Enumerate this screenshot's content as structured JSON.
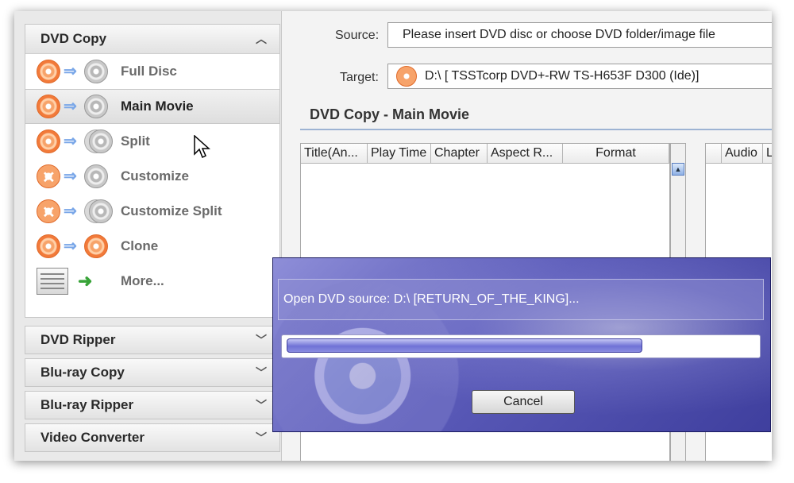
{
  "left_panel": {
    "dvd_copy": {
      "title": "DVD Copy",
      "items": [
        {
          "label": "Full Disc"
        },
        {
          "label": "Main Movie"
        },
        {
          "label": "Split"
        },
        {
          "label": "Customize"
        },
        {
          "label": "Customize Split"
        },
        {
          "label": "Clone"
        },
        {
          "label": "More..."
        }
      ]
    },
    "collapsed_sections": [
      "DVD Ripper",
      "Blu-ray Copy",
      "Blu-ray Ripper",
      "Video Converter"
    ]
  },
  "main": {
    "source_label": "Source:",
    "source_value": "Please insert DVD disc or choose DVD folder/image file",
    "target_label": "Target:",
    "target_value": "D:\\ [ TSSTcorp DVD+-RW TS-H653F D300 (Ide)]",
    "section_title": "DVD Copy - Main Movie",
    "columns": [
      "Title(An...",
      "Play Time",
      "Chapter",
      "Aspect R...",
      "Format"
    ],
    "columns2": [
      "Audio",
      "L"
    ]
  },
  "dialog": {
    "message": "Open DVD source:  D:\\ [RETURN_OF_THE_KING]...",
    "progress": 0.76,
    "cancel_label": "Cancel"
  },
  "colors": {
    "accent_blue": "#9db3d3",
    "dialog_purple": "#5a5ab8",
    "disc_orange": "#f27a3a"
  }
}
